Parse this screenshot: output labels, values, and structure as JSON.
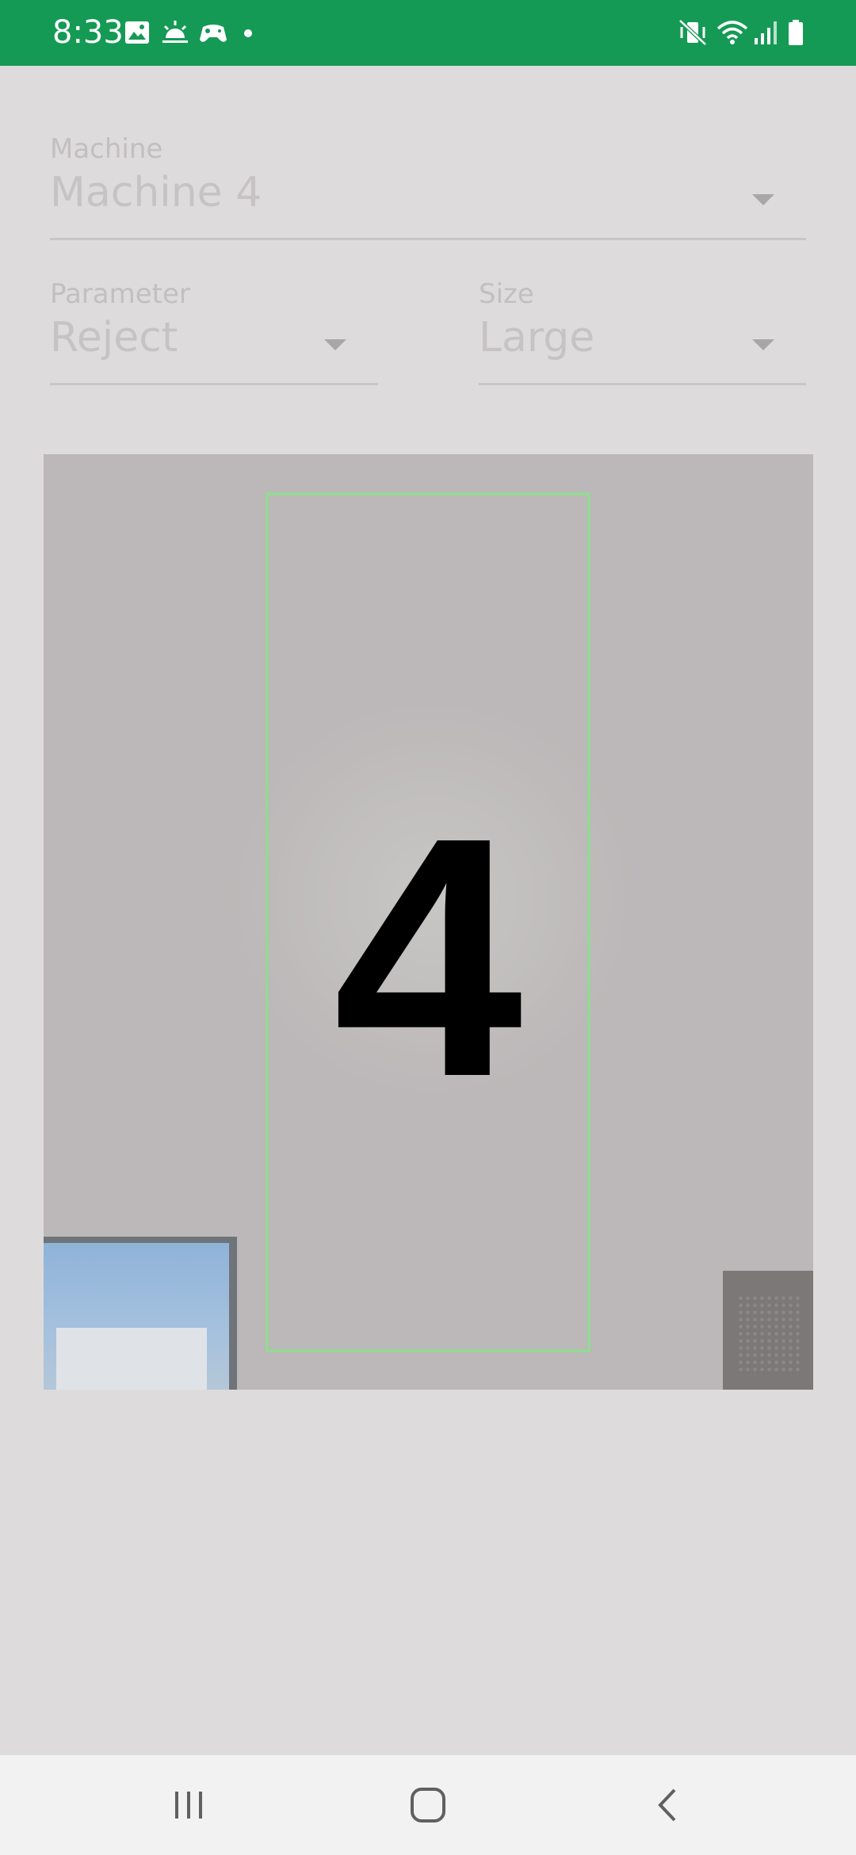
{
  "status_bar": {
    "time": "8:33",
    "icons": [
      "image-icon",
      "sunrise-icon",
      "game-controller-icon",
      "notification-dot-icon",
      "mute-vibrate-icon",
      "wifi-icon",
      "signal-icon",
      "battery-icon"
    ],
    "background": "#159a55"
  },
  "form": {
    "machine": {
      "label": "Machine",
      "value": "Machine 4"
    },
    "parameter": {
      "label": "Parameter",
      "value": "Reject"
    },
    "size": {
      "label": "Size",
      "value": "Large"
    }
  },
  "camera": {
    "detected_digit": "4",
    "frame_color": "#96d796"
  },
  "nav_bar": {
    "buttons": [
      "recent-apps-icon",
      "home-icon",
      "back-icon"
    ]
  }
}
